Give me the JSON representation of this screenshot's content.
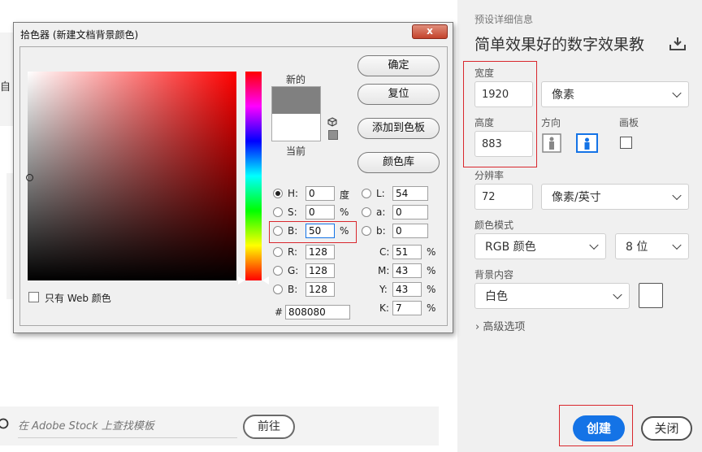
{
  "background": {
    "partial_text": "自",
    "search": {
      "placeholder": "在 Adobe Stock 上查找模板"
    },
    "goto_label": "前往"
  },
  "preset": {
    "section_label": "预设详细信息",
    "title": "简单效果好的数字效果教",
    "width_label": "宽度",
    "width_value": "1920",
    "unit": "像素",
    "height_label": "高度",
    "height_value": "883",
    "orientation_label": "方向",
    "artboard_label": "画板",
    "resolution_label": "分辨率",
    "resolution_value": "72",
    "resolution_unit": "像素/英寸",
    "color_mode_label": "颜色模式",
    "color_mode": "RGB 颜色",
    "bit_depth": "8 位",
    "background_label": "背景内容",
    "background_value": "白色",
    "advanced_label": "高级选项",
    "create_label": "创建",
    "close_label": "关闭"
  },
  "picker": {
    "title": "拾色器 (新建文档背景颜色)",
    "close_glyph": "x",
    "new_label": "新的",
    "current_label": "当前",
    "buttons": {
      "ok": "确定",
      "reset": "复位",
      "add_swatch": "添加到色板",
      "libraries": "颜色库"
    },
    "web_only_label": "只有 Web 颜色",
    "hsb": {
      "h": {
        "label": "H:",
        "value": "0",
        "unit": "度"
      },
      "s": {
        "label": "S:",
        "value": "0",
        "unit": "%"
      },
      "b": {
        "label": "B:",
        "value": "50",
        "unit": "%"
      }
    },
    "rgb": {
      "r": {
        "label": "R:",
        "value": "128"
      },
      "g": {
        "label": "G:",
        "value": "128"
      },
      "b": {
        "label": "B:",
        "value": "128"
      }
    },
    "lab": {
      "l": {
        "label": "L:",
        "value": "54"
      },
      "a": {
        "label": "a:",
        "value": "0"
      },
      "b": {
        "label": "b:",
        "value": "0"
      }
    },
    "cmyk": {
      "c": {
        "label": "C:",
        "value": "51",
        "unit": "%"
      },
      "m": {
        "label": "M:",
        "value": "43",
        "unit": "%"
      },
      "y": {
        "label": "Y:",
        "value": "43",
        "unit": "%"
      },
      "k": {
        "label": "K:",
        "value": "7",
        "unit": "%"
      }
    },
    "hex_label": "#",
    "hex_value": "808080",
    "new_color": "#808080",
    "current_color": "#ffffff"
  },
  "colors": {
    "accent": "#1473e6",
    "highlight_box": "#d9272d"
  }
}
